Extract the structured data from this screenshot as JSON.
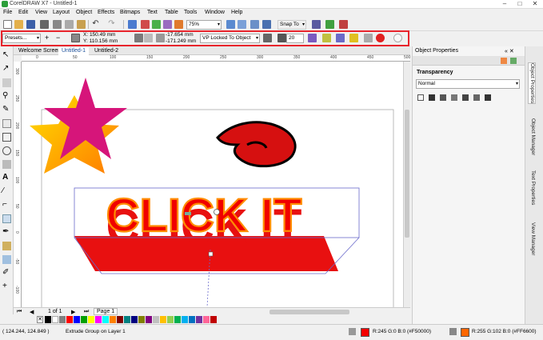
{
  "app": {
    "title": "CorelDRAW X7 - Untitled-1"
  },
  "menu": [
    "File",
    "Edit",
    "View",
    "Layout",
    "Object",
    "Effects",
    "Bitmaps",
    "Text",
    "Table",
    "Tools",
    "Window",
    "Help"
  ],
  "toolbar": {
    "zoom": "75%",
    "snap_to": "Snap To"
  },
  "propbar": {
    "presets": "Presets...",
    "x": "X: 150.49 mm",
    "y": "Y: 110.156 mm",
    "vp_x": "-17.654 mm",
    "vp_y": "-171.249 mm",
    "vp_lock": "VP Locked To Object",
    "depth": "20"
  },
  "tabs": [
    "Welcome Screen",
    "Untitled-1",
    "Untitled-2"
  ],
  "hruler_ticks": [
    "0",
    "50",
    "100",
    "150",
    "200",
    "250",
    "300",
    "350",
    "400",
    "450",
    "500"
  ],
  "vruler_ticks": [
    "300",
    "250",
    "200",
    "150",
    "100",
    "50",
    "0",
    "-50",
    "-100"
  ],
  "canvas": {
    "text": "CLICK IT"
  },
  "page_nav": {
    "page_of": "1 of 1",
    "page_tab": "Page 1"
  },
  "palette_colors": [
    "#000000",
    "#ffffff",
    "#7f7f7f",
    "#ff0000",
    "#0000ff",
    "#00a000",
    "#ffff00",
    "#ff00ff",
    "#00ffff",
    "#ff8000",
    "#800000",
    "#008080",
    "#000080",
    "#808000",
    "#800080",
    "#c0c0c0",
    "#ffc000",
    "#92d050",
    "#00b050",
    "#00b0f0",
    "#0070c0",
    "#7030a0",
    "#ff6699",
    "#c00000"
  ],
  "status": {
    "coords": "( 124.244, 124.849 )",
    "selection": "Extrude Group on Layer 1",
    "fill": "R:245 G:0 B:0 (#F50000)",
    "fill_color": "#f50000",
    "outline": "R:255 G:102 B:0 (#FF6600)",
    "outline_color": "#ff6600"
  },
  "panel": {
    "title": "Object Properties",
    "section": "Transparency",
    "mode": "Normal"
  },
  "side_tabs": [
    "Object Properties",
    "Object Manager",
    "Text Properties",
    "View Manager"
  ]
}
